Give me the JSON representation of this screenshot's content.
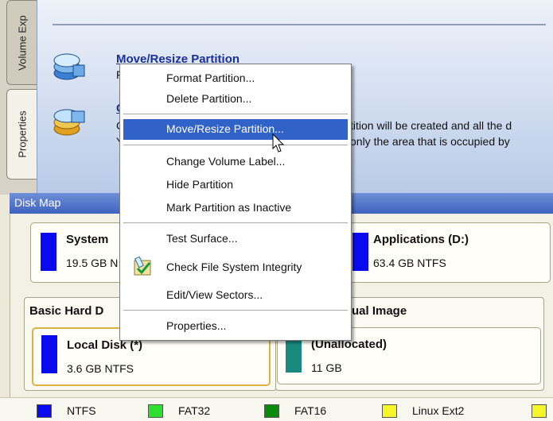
{
  "tabs": [
    {
      "label": "Volume Exp",
      "active": false
    },
    {
      "label": "Properties",
      "active": true
    }
  ],
  "top_panel": {
    "item1_title": "Move/Resize Partition",
    "item1_text": "F",
    "item2_title": "C",
    "item2_text_line1": "C",
    "item2_text_line2": "Y",
    "right_text_line1": "tition will be created and all the d",
    "right_text_line2": "only the area that is occupied by"
  },
  "disk_map": {
    "header": "Disk Map",
    "disk1_partitions": [
      {
        "name": "System",
        "size": "19.5 GB N",
        "color": "#0a0af0"
      },
      {
        "name": "Applications (D:)",
        "size": "63.4 GB NTFS",
        "color": "#0a0af0"
      }
    ],
    "disk2_label": "Basic Hard D",
    "disk3_label": "tual Image",
    "disk2_partition": {
      "name": "Local Disk (*)",
      "size": "3.6 GB NTFS",
      "color": "#0a0af0"
    },
    "disk3_partition": {
      "name": "(Unallocated)",
      "size": "11 GB",
      "color": "#1a8a80"
    }
  },
  "legend": [
    {
      "label": "NTFS",
      "color": "#0a0af0"
    },
    {
      "label": "FAT32",
      "color": "#2ee02e"
    },
    {
      "label": "FAT16",
      "color": "#0a8a0a"
    },
    {
      "label": "Linux Ext2",
      "color": "#f5f52a"
    }
  ],
  "context_menu": {
    "items": [
      {
        "label": "Format Partition..."
      },
      {
        "label": "Delete Partition..."
      },
      {
        "label": "Move/Resize Partition...",
        "highlighted": true
      },
      {
        "label": "Change Volume Label..."
      },
      {
        "label": "Hide Partition"
      },
      {
        "label": "Mark Partition as Inactive"
      },
      {
        "label": "Test Surface..."
      },
      {
        "label": "Check File System Integrity"
      },
      {
        "label": "Edit/View Sectors..."
      },
      {
        "label": "Properties..."
      }
    ]
  }
}
